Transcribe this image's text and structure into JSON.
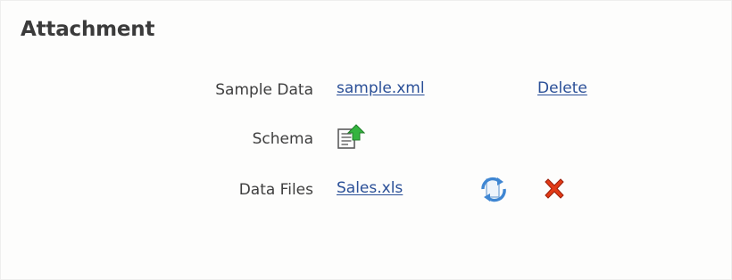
{
  "section": {
    "title": "Attachment"
  },
  "rows": {
    "sample_data": {
      "label": "Sample Data",
      "file_link": "sample.xml",
      "delete_link": "Delete"
    },
    "schema": {
      "label": "Schema",
      "upload_icon": "upload-document-icon"
    },
    "data_files": {
      "label": "Data Files",
      "file_link": "Sales.xls",
      "refresh_icon": "refresh-icon",
      "delete_icon": "delete-x-icon"
    }
  },
  "colors": {
    "link": "#2a4f97",
    "label": "#3e3e3e",
    "heading": "#3b3b3b",
    "delete_icon": "#e23a16",
    "refresh_icon": "#3f86d2",
    "upload_arrow": "#34b43f"
  }
}
